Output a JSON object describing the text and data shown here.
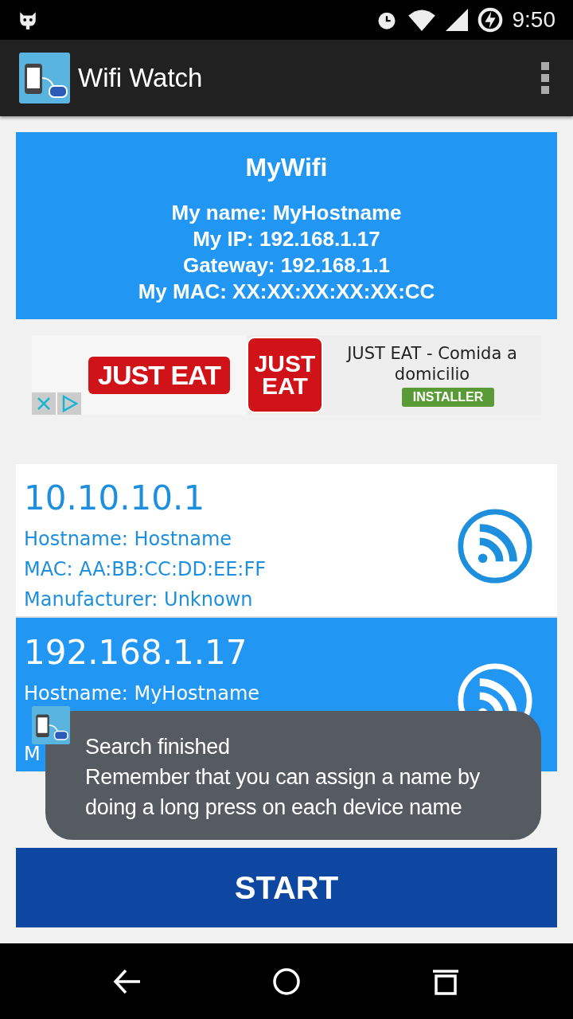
{
  "status_bar": {
    "time": "9:50"
  },
  "app_bar": {
    "title": "Wifi Watch"
  },
  "network": {
    "ssid": "MyWifi",
    "lines": [
      "My name: MyHostname",
      "My IP: 192.168.1.17",
      "Gateway: 192.168.1.1",
      "My MAC: XX:XX:XX:XX:XX:CC"
    ]
  },
  "ad": {
    "title": "JUST EAT - Comida a domicilio",
    "button": "INSTALLER",
    "logo_wide": "JUST EAT",
    "logo_square": [
      "JUST",
      "EAT"
    ]
  },
  "devices": [
    {
      "ip": "10.10.10.1",
      "hostname": "Hostname: Hostname",
      "mac": "MAC: AA:BB:CC:DD:EE:FF",
      "manufacturer": "Manufacturer: Unknown",
      "selected": false
    },
    {
      "ip": "192.168.1.17",
      "hostname": "Hostname: MyHostname",
      "manufacturer": "M",
      "selected": true
    }
  ],
  "toast": {
    "lines": [
      "Search finished",
      "Remember that you can assign a name by doing a long press on each device name"
    ]
  },
  "start_button": "START"
}
